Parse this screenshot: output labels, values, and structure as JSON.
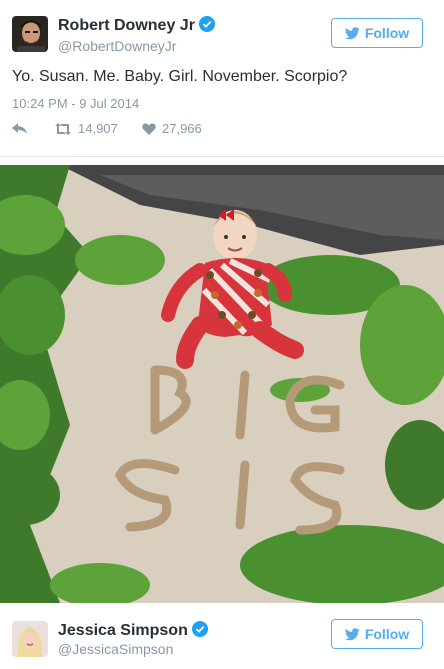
{
  "tweet1": {
    "author_name": "Robert Downey Jr",
    "handle": "@RobertDowneyJr",
    "follow_label": "Follow",
    "text": "Yo. Susan. Me. Baby. Girl. November. Scorpio?",
    "timestamp": "10:24 PM - 9 Jul 2014",
    "retweets": "14,907",
    "favorites": "27,966"
  },
  "photo": {
    "sand_words": [
      "BIG",
      "SIS"
    ]
  },
  "tweet2": {
    "author_name": "Jessica Simpson",
    "handle": "@JessicaSimpson",
    "follow_label": "Follow"
  },
  "colors": {
    "twitter_blue": "#55acee",
    "text_gray": "#8899a6",
    "verified_blue": "#1da1f2"
  }
}
